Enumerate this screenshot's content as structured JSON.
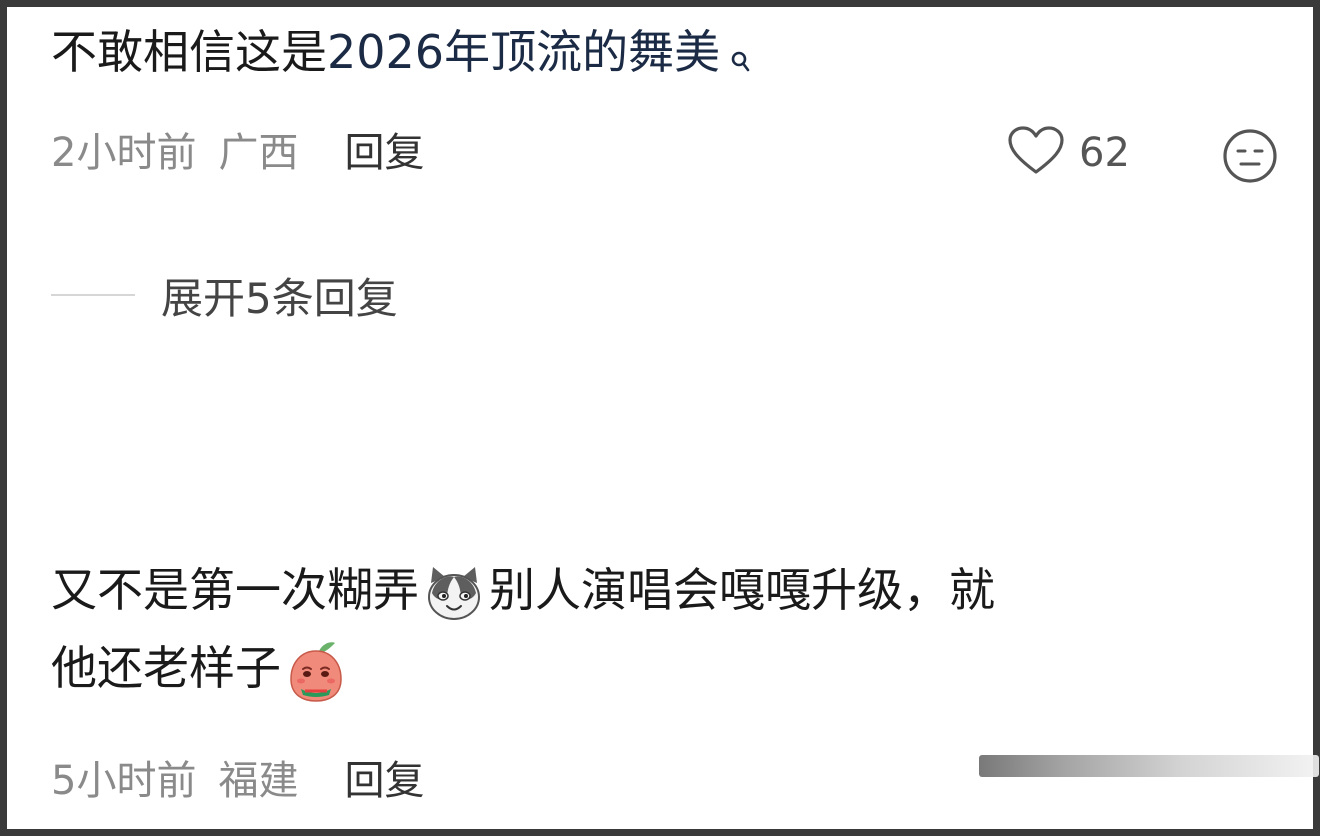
{
  "comments": [
    {
      "text_prefix": "不敢相信这是",
      "text_keyword": "2026年顶流的舞美",
      "time": "2小时前",
      "location": "广西",
      "reply_label": "回复",
      "like_count": "62",
      "expand_label": "展开5条回复"
    },
    {
      "line1_part1": "又不是第一次糊弄",
      "line1_part2": "别人演唱会嘎嘎升级，就",
      "line2": "他还老样子",
      "emoji_1": "cat-face-icon",
      "emoji_2": "peach-crying-icon",
      "time": "5小时前",
      "location": "福建",
      "reply_label": "回复"
    }
  ],
  "icons": {
    "search": "search-icon",
    "like": "heart-outline-icon",
    "dislike": "meh-face-icon"
  },
  "colors": {
    "keyword": "#1c2b45",
    "meta_text": "#8a8a8a",
    "reply_text": "#333333",
    "frame": "#3a3a3a"
  }
}
